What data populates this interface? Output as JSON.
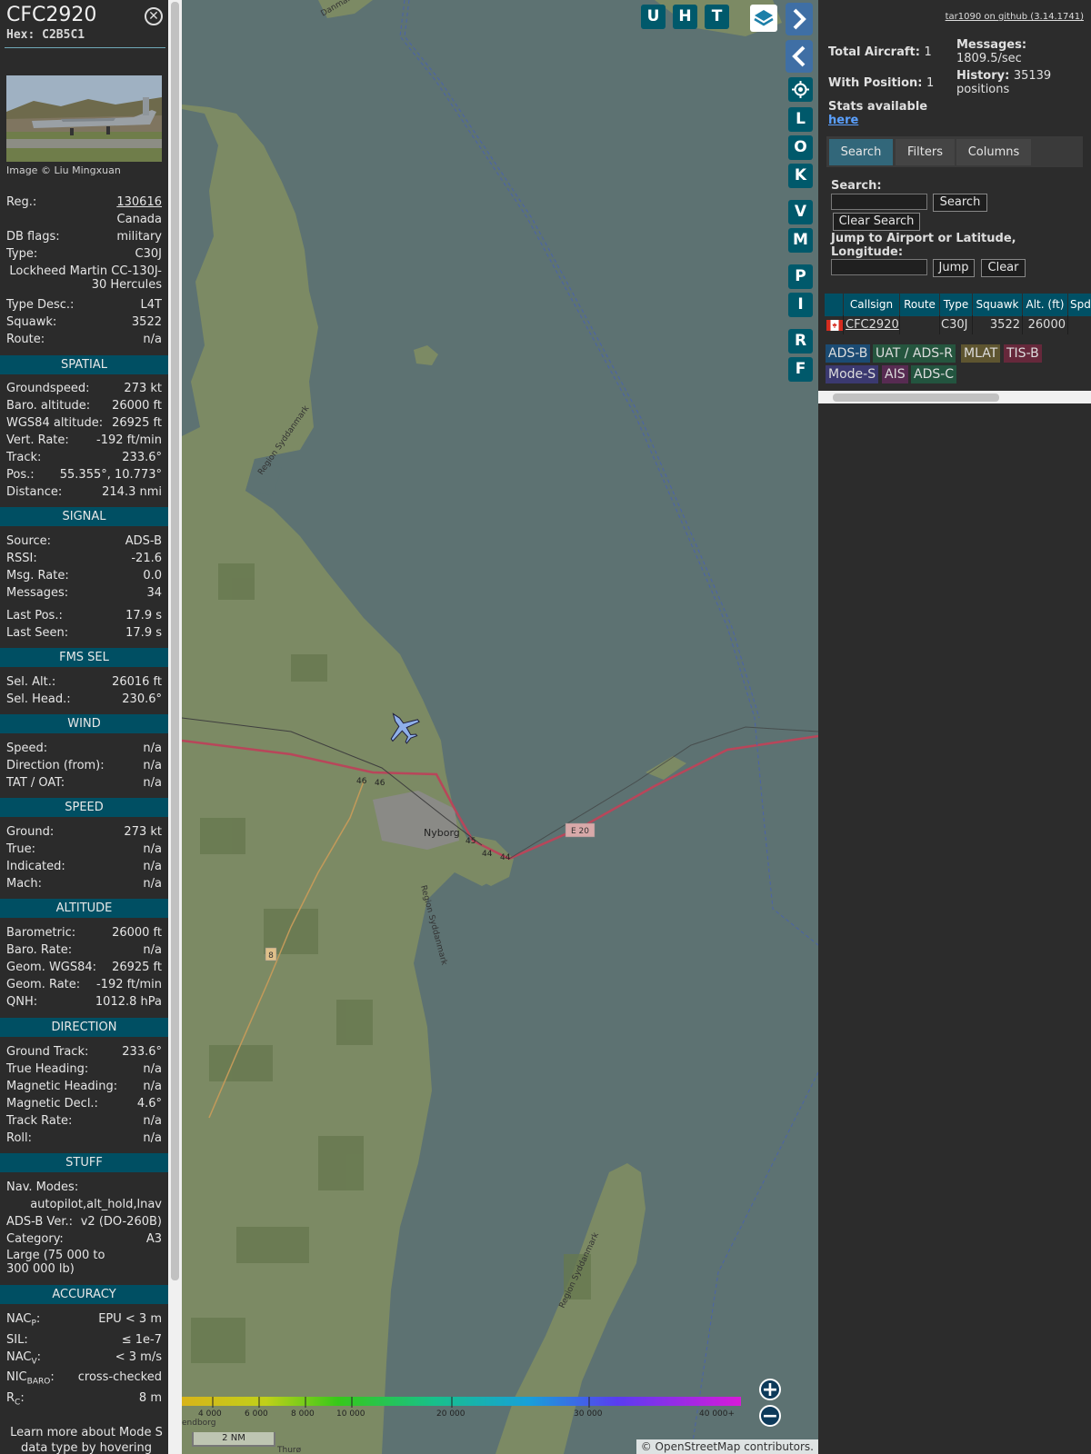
{
  "aircraft": {
    "callsign": "CFC2920",
    "hex": "Hex: C2B5C1",
    "image_credit": "Image © Liu Mingxuan",
    "reg_label": "Reg.:",
    "reg": "130616",
    "country": "Canada",
    "dbflags_label": "DB flags:",
    "dbflags": "military",
    "type_label": "Type:",
    "type": "C30J",
    "type_full": "Lockheed Martin CC-130J-30 Hercules",
    "typedesc_label": "Type Desc.:",
    "typedesc": "L4T",
    "squawk_label": "Squawk:",
    "squawk": "3522",
    "route_label": "Route:",
    "route": "n/a"
  },
  "sections": {
    "spatial": "SPATIAL",
    "signal": "SIGNAL",
    "fms": "FMS SEL",
    "wind": "WIND",
    "speed": "SPEED",
    "altitude": "ALTITUDE",
    "direction": "DIRECTION",
    "stuff": "STUFF",
    "accuracy": "ACCURACY"
  },
  "spatial": {
    "gs_label": "Groundspeed:",
    "gs": "273 kt",
    "baro_label": "Baro. altitude:",
    "baro": "26000 ft",
    "wgs_label": "WGS84 altitude:",
    "wgs": "26925 ft",
    "vr_label": "Vert. Rate:",
    "vr": "-192 ft/min",
    "track_label": "Track:",
    "track": "233.6°",
    "pos_label": "Pos.:",
    "pos": "55.355°, 10.773°",
    "dist_label": "Distance:",
    "dist": "214.3 nmi"
  },
  "signal": {
    "source_label": "Source:",
    "source": "ADS-B",
    "rssi_label": "RSSI:",
    "rssi": "-21.6",
    "msgrate_label": "Msg. Rate:",
    "msgrate": "0.0",
    "messages_label": "Messages:",
    "messages": "34",
    "lastpos_label": "Last Pos.:",
    "lastpos": "17.9 s",
    "lastseen_label": "Last Seen:",
    "lastseen": "17.9 s"
  },
  "fms": {
    "selalt_label": "Sel. Alt.:",
    "selalt": "26016 ft",
    "selhead_label": "Sel. Head.:",
    "selhead": "230.6°"
  },
  "wind": {
    "speed_label": "Speed:",
    "speed": "n/a",
    "dir_label": "Direction (from):",
    "dir": "n/a",
    "tat_label": "TAT / OAT:",
    "tat": "n/a"
  },
  "speed": {
    "ground_label": "Ground:",
    "ground": "273 kt",
    "true_label": "True:",
    "true": "n/a",
    "ind_label": "Indicated:",
    "ind": "n/a",
    "mach_label": "Mach:",
    "mach": "n/a"
  },
  "altitude": {
    "baro_label": "Barometric:",
    "baro": "26000 ft",
    "barorate_label": "Baro. Rate:",
    "barorate": "n/a",
    "geom_label": "Geom. WGS84:",
    "geom": "26925 ft",
    "geomrate_label": "Geom. Rate:",
    "geomrate": "-192 ft/min",
    "qnh_label": "QNH:",
    "qnh": "1012.8 hPa"
  },
  "direction": {
    "gt_label": "Ground Track:",
    "gt": "233.6°",
    "th_label": "True Heading:",
    "th": "n/a",
    "mh_label": "Magnetic Heading:",
    "mh": "n/a",
    "md_label": "Magnetic Decl.:",
    "md": "4.6°",
    "tr_label": "Track Rate:",
    "tr": "n/a",
    "roll_label": "Roll:",
    "roll": "n/a"
  },
  "stuff": {
    "navmodes_label": "Nav. Modes:",
    "navmodes": "autopilot,alt_hold,lnav",
    "adsbver_label": "ADS-B Ver.:",
    "adsbver": "v2 (DO-260B)",
    "category_label": "Category:",
    "category": "A3",
    "category_desc": "Large (75 000 to 300 000 lb)"
  },
  "accuracy": {
    "nacp_label": "NAC",
    "nacp_sub": "P",
    "nacp": "EPU < 3 m",
    "sil_label": "SIL:",
    "sil": "≤ 1e-7",
    "nacv_label": "NAC",
    "nacv_sub": "V",
    "nacv": "< 3 m/s",
    "nicbaro_label": "NIC",
    "nicbaro_sub": "BARO",
    "nicbaro": "cross-checked",
    "rc_label": "R",
    "rc_sub": "C",
    "rc": "8 m"
  },
  "footer_text": "Learn more about Mode S data type by hovering over",
  "map": {
    "buttons": [
      "U",
      "H",
      "T"
    ],
    "side_buttons": [
      "L",
      "O",
      "K",
      "V",
      "M",
      "P",
      "I",
      "R",
      "F"
    ],
    "places": {
      "nyborg": "Nyborg",
      "region1": "Region Syddanmark",
      "region2": "Region Syddanmark",
      "region3": "Region Syddanmark",
      "road_e20": "E 20",
      "road_46a": "46",
      "road_46b": "46",
      "road_45": "45",
      "road_44a": "44",
      "road_44b": "44",
      "road_8": "8",
      "thuro": "Thurø",
      "dan": "Danmark",
      "svd": "endborg"
    },
    "altitude_scale": [
      "4 000",
      "6 000",
      "8 000",
      "10 000",
      "20 000",
      "30 000",
      "40 000+"
    ],
    "scale_label": "2 NM",
    "attribution_pre": "© ",
    "attribution_link": "OpenStreetMap",
    "attribution_post": " contributors."
  },
  "sidebar": {
    "github_link": "tar1090 on github (3.14.1741)",
    "total_label": "Total Aircraft:",
    "total": "1",
    "withpos_label": "With Position:",
    "withpos": "1",
    "stats_label": "Stats available",
    "stats_link": "here",
    "messages_label": "Messages:",
    "messages": "1809.5/sec",
    "history_label": "History:",
    "history": "35139 positions",
    "tabs": [
      "Search",
      "Filters",
      "Columns"
    ],
    "search_label": "Search:",
    "search_button": "Search",
    "clear_search_button": "Clear Search",
    "jump_label": "Jump to Airport or Latitude, Longitude:",
    "jump_button": "Jump",
    "clear_button": "Clear",
    "columns": [
      "Callsign",
      "Route",
      "Type",
      "Squawk",
      "Alt. (ft)",
      "Spd"
    ],
    "rows": [
      {
        "callsign": "CFC2920",
        "route": "",
        "type": "C30J",
        "squawk": "3522",
        "alt": "26000"
      }
    ],
    "chips": [
      "ADS-B",
      "UAT / ADS-R",
      "MLAT",
      "TIS-B",
      "Mode-S",
      "AIS",
      "ADS-C"
    ]
  },
  "colors": {
    "section_header": "#004f63",
    "chip_adsb": "#1b4b73",
    "chip_uat": "#25553e",
    "chip_mlat": "#5e5530",
    "chip_tisb": "#66283b",
    "chip_modes": "#3b3970",
    "chip_ais": "#572b52",
    "chip_adsc": "#23543f"
  }
}
